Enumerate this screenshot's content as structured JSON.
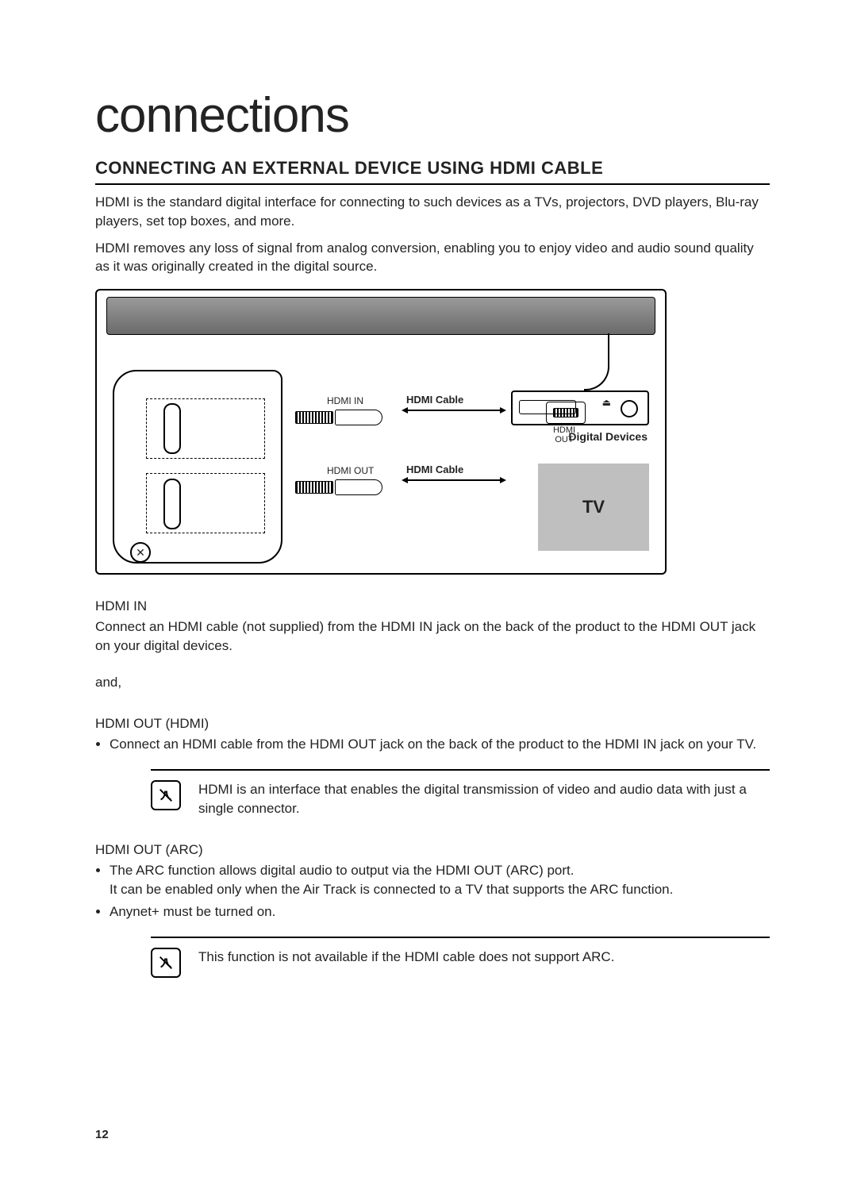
{
  "title": "connections",
  "heading": "CONNECTING AN EXTERNAL DEVICE USING HDMI CABLE",
  "intro1": "HDMI is the standard digital interface for connecting to such devices as a TVs, projectors, DVD players, Blu-ray players, set top boxes, and more.",
  "intro2": "HDMI removes any loss of signal from analog conversion, enabling you to enjoy video and audio sound quality as it was originally created in the digital source.",
  "diagram": {
    "hdmi_in_label": "HDMI IN",
    "hdmi_out_label": "HDMI OUT",
    "cable_label": "HDMI Cable",
    "jack_out_label": "HDMI OUT",
    "jack_in_label": "HDMI  IN",
    "digital_devices": "Digital Devices",
    "tv_label": "TV"
  },
  "hdmi_in": {
    "head": "HDMI IN",
    "body": "Connect an HDMI cable (not supplied) from the HDMI IN jack on the back of the product to the HDMI OUT jack on your digital devices."
  },
  "and_word": "and,",
  "hdmi_out_hdmi": {
    "head": "HDMI OUT (HDMI)",
    "bullet1": "Connect an HDMI cable from the HDMI OUT jack on the back of the product to the HDMI IN jack on your TV."
  },
  "note1": "HDMI is an interface that enables the digital transmission of video and audio data with just a single connector.",
  "hdmi_out_arc": {
    "head": "HDMI OUT (ARC)",
    "bullet1a": "The ARC function allows digital audio to output via the HDMI OUT (ARC) port.",
    "bullet1b": "It can be enabled only when the Air Track is connected to a TV that supports the ARC function.",
    "bullet2": "Anynet+ must be turned on."
  },
  "note2": "This function is not available if the HDMI cable does not support ARC.",
  "page_number": "12"
}
